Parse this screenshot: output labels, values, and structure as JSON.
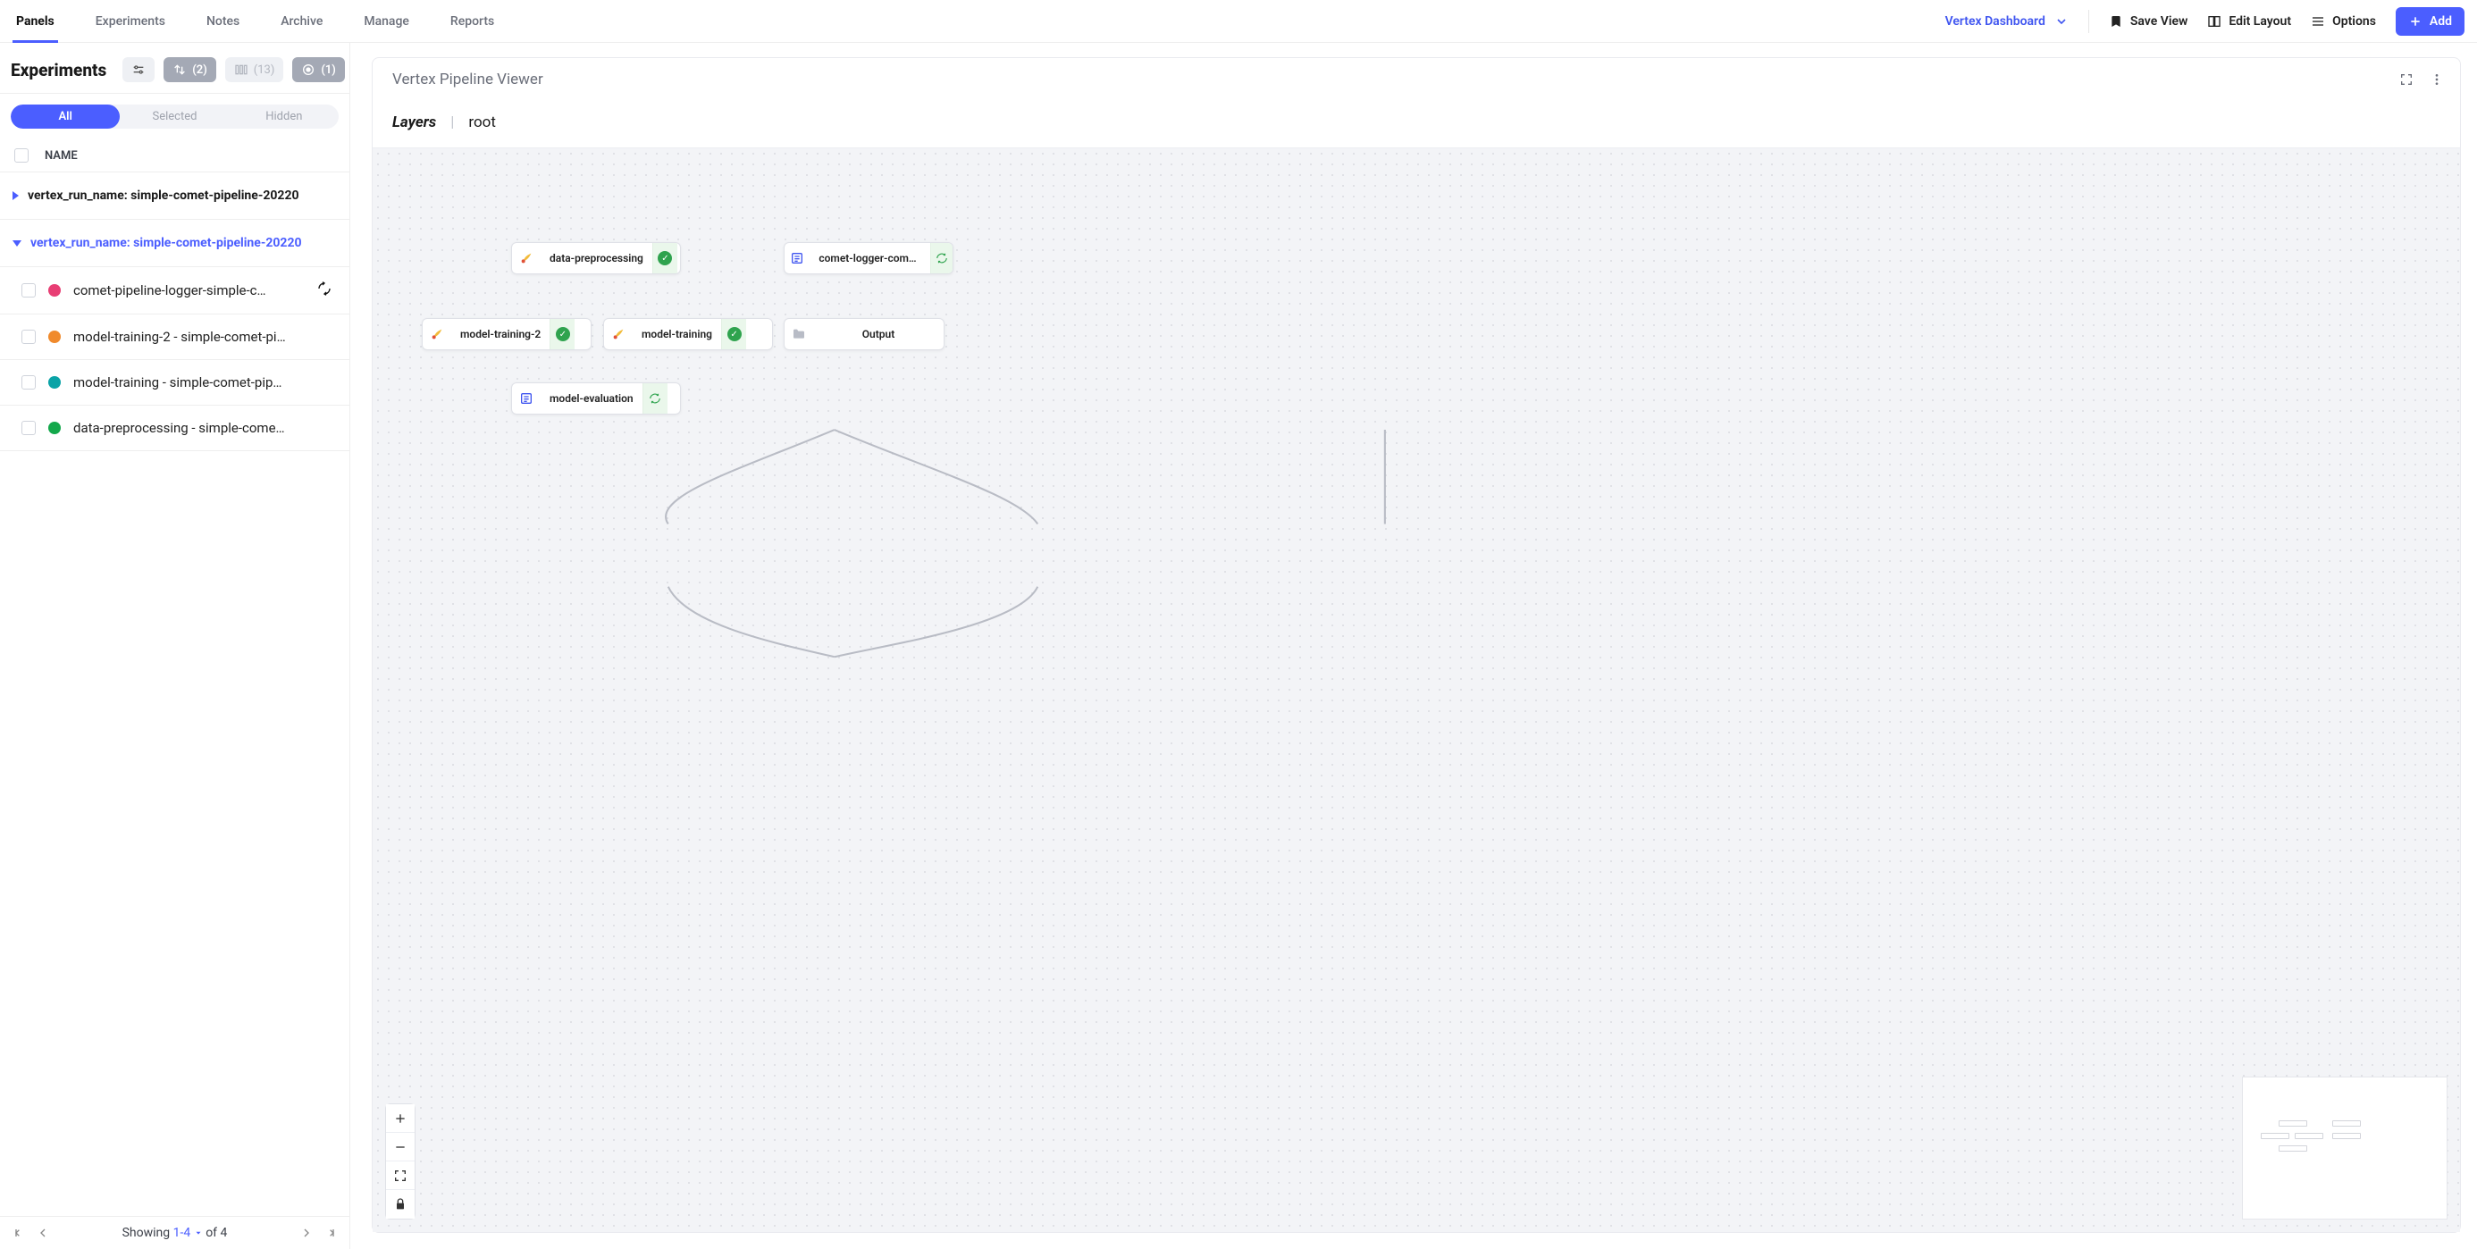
{
  "topnav": {
    "tabs": [
      "Panels",
      "Experiments",
      "Notes",
      "Archive",
      "Manage",
      "Reports"
    ],
    "active_tab": "Panels",
    "dashboard_label": "Vertex Dashboard",
    "save_view": "Save View",
    "edit_layout": "Edit Layout",
    "options": "Options",
    "add": "Add"
  },
  "sidebar": {
    "title": "Experiments",
    "filter_badges": {
      "sort": "(2)",
      "cols": "(13)",
      "target": "(1)"
    },
    "segments": {
      "all": "All",
      "selected": "Selected",
      "hidden": "Hidden"
    },
    "col_name": "NAME",
    "groups": [
      {
        "label": "vertex_run_name: simple-comet-pipeline-20220",
        "expanded": false
      },
      {
        "label": "vertex_run_name: simple-comet-pipeline-20220",
        "expanded": true
      }
    ],
    "rows": [
      {
        "color": "#e83e74",
        "label": "comet-pipeline-logger-simple-c…",
        "loading": true
      },
      {
        "color": "#f08a2c",
        "label": "model-training-2 - simple-comet-pi…"
      },
      {
        "color": "#0aa3a7",
        "label": "model-training - simple-comet-pip…"
      },
      {
        "color": "#13a84b",
        "label": "data-preprocessing - simple-come…"
      }
    ],
    "pager": {
      "showing": "Showing",
      "range": "1-4",
      "of": "of 4"
    }
  },
  "panel": {
    "title": "Vertex Pipeline Viewer",
    "layers_label": "Layers",
    "root_label": "root"
  },
  "nodes": {
    "data_pre": "data-preprocessing",
    "mt2": "model-training-2",
    "mt": "model-training",
    "me": "model-evaluation",
    "logger": "comet-logger-compon…",
    "output": "Output"
  }
}
